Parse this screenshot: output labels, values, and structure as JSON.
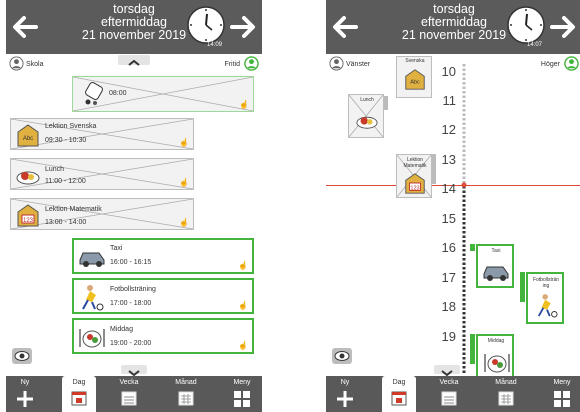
{
  "left": {
    "header": {
      "line1": "torsdag",
      "line2": "eftermiddag",
      "line3": "21 november 2019",
      "clock_time": "14:09"
    },
    "sub": {
      "left_label": "Skola",
      "right_label": "Fritid"
    },
    "cards": [
      {
        "title": "",
        "time": "08:00"
      },
      {
        "title": "Lektion Svenska",
        "time": "09:30 - 10:30"
      },
      {
        "title": "Lunch",
        "time": "11:00 - 12:00"
      },
      {
        "title": "Lektion Matematik",
        "time": "13:00 - 14:00"
      },
      {
        "title": "Taxi",
        "time": "16:00 - 16:15"
      },
      {
        "title": "Fotbollsträning",
        "time": "17:00 - 18:00"
      },
      {
        "title": "Middag",
        "time": "19:00 - 20:00"
      }
    ]
  },
  "right": {
    "header": {
      "line1": "torsdag",
      "line2": "eftermiddag",
      "line3": "21 november 2019",
      "clock_time": "14:07"
    },
    "sub": {
      "left_label": "Vänster",
      "right_label": "Höger"
    },
    "hours": [
      "10",
      "11",
      "12",
      "13",
      "14",
      "15",
      "16",
      "17",
      "18",
      "19"
    ],
    "cards": [
      {
        "title": "Svenska"
      },
      {
        "title": "Lunch"
      },
      {
        "title": "Lektion Matematik"
      },
      {
        "title": "Taxi"
      },
      {
        "title": "Fotbollsträn ing"
      },
      {
        "title": "Middag"
      }
    ]
  },
  "tabs": [
    {
      "label": "Ny"
    },
    {
      "label": "Dag"
    },
    {
      "label": "Vecka"
    },
    {
      "label": "Månad"
    },
    {
      "label": "Meny"
    }
  ],
  "colors": {
    "header_bg": "#5b5b5b",
    "green": "#43b43c",
    "now_line": "#e04a3a",
    "tab_bg": "#595959"
  }
}
